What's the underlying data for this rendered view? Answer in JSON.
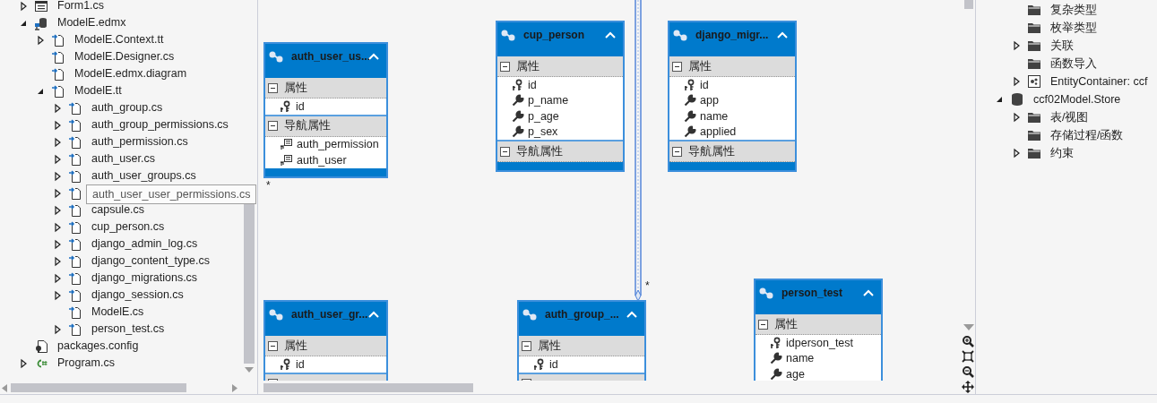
{
  "solution_tree": [
    {
      "label": "Form1.cs",
      "kind": "form",
      "expanded": false
    },
    {
      "label": "ModelE.edmx",
      "kind": "edmx",
      "expanded": true,
      "children": [
        {
          "label": "ModelE.Context.tt",
          "kind": "tt",
          "expanded": false
        },
        {
          "label": "ModelE.Designer.cs",
          "kind": "tt"
        },
        {
          "label": "ModelE.edmx.diagram",
          "kind": "tt"
        },
        {
          "label": "ModelE.tt",
          "kind": "tt",
          "expanded": true,
          "children": [
            {
              "label": "auth_group.cs",
              "kind": "tt",
              "expanded": false
            },
            {
              "label": "auth_group_permissions.cs",
              "kind": "tt",
              "expanded": false
            },
            {
              "label": "auth_permission.cs",
              "kind": "tt",
              "expanded": false
            },
            {
              "label": "auth_user.cs",
              "kind": "tt",
              "expanded": false
            },
            {
              "label": "auth_user_groups.cs",
              "kind": "tt",
              "expanded": false
            },
            {
              "kind": "tt",
              "expanded": false
            },
            {
              "label": "capsule.cs",
              "kind": "tt",
              "expanded": false
            },
            {
              "label": "cup_person.cs",
              "kind": "tt",
              "expanded": false
            },
            {
              "label": "django_admin_log.cs",
              "kind": "tt",
              "expanded": false
            },
            {
              "label": "django_content_type.cs",
              "kind": "tt",
              "expanded": false
            },
            {
              "label": "django_migrations.cs",
              "kind": "tt",
              "expanded": false
            },
            {
              "label": "django_session.cs",
              "kind": "tt",
              "expanded": false
            },
            {
              "label": "ModelE.cs",
              "kind": "tt"
            },
            {
              "label": "person_test.cs",
              "kind": "tt",
              "expanded": false
            }
          ]
        }
      ]
    },
    {
      "label": "packages.config",
      "kind": "config"
    },
    {
      "label": "Program.cs",
      "kind": "csharp",
      "expanded": false
    }
  ],
  "tooltip": {
    "text": "auth_user_user_permissions.cs"
  },
  "entities": [
    {
      "title": "auth_user_us...",
      "expanded": true,
      "sections": [
        {
          "label": "属性",
          "expanded": true,
          "rows": [
            {
              "name": "id",
              "kind": "key"
            }
          ]
        },
        {
          "label": "导航属性",
          "expanded": true,
          "rows": [
            {
              "name": "auth_permission",
              "kind": "navigation"
            },
            {
              "name": "auth_user",
              "kind": "navigation"
            }
          ]
        }
      ]
    },
    {
      "title": "cup_person",
      "expanded": true,
      "sections": [
        {
          "label": "属性",
          "expanded": true,
          "rows": [
            {
              "name": "id",
              "kind": "key"
            },
            {
              "name": "p_name",
              "kind": "property"
            },
            {
              "name": "p_age",
              "kind": "property"
            },
            {
              "name": "p_sex",
              "kind": "property"
            }
          ]
        },
        {
          "label": "导航属性",
          "expanded": true
        }
      ]
    },
    {
      "title": "django_migr...",
      "expanded": true,
      "sections": [
        {
          "label": "属性",
          "expanded": true,
          "rows": [
            {
              "name": "id",
              "kind": "key"
            },
            {
              "name": "app",
              "kind": "property"
            },
            {
              "name": "name",
              "kind": "property"
            },
            {
              "name": "applied",
              "kind": "property"
            }
          ]
        },
        {
          "label": "导航属性",
          "expanded": true
        }
      ]
    },
    {
      "title": "auth_user_gr...",
      "expanded": true,
      "sections": [
        {
          "label": "属性",
          "expanded": true,
          "rows": [
            {
              "name": "id",
              "kind": "key"
            }
          ]
        },
        {
          "expanded": true
        }
      ]
    },
    {
      "title": "auth_group_...",
      "expanded": true,
      "sections": [
        {
          "label": "属性",
          "expanded": true,
          "rows": [
            {
              "name": "id",
              "kind": "key"
            }
          ]
        },
        {
          "expanded": true
        }
      ]
    },
    {
      "title": "person_test",
      "expanded": true,
      "sections": [
        {
          "label": "属性",
          "expanded": true,
          "rows": [
            {
              "name": "idperson_test",
              "kind": "key"
            },
            {
              "name": "name",
              "kind": "property"
            },
            {
              "name": "age",
              "kind": "property"
            }
          ]
        }
      ]
    }
  ],
  "multiplicity_labels": [
    "*",
    "*"
  ],
  "model_browser": {
    "continued_items": [
      {
        "label": "复杂类型",
        "kind": "folder"
      },
      {
        "label": "枚举类型",
        "kind": "folder"
      },
      {
        "label": "关联",
        "kind": "folder",
        "expanded": false
      },
      {
        "label": "函数导入",
        "kind": "folder"
      },
      {
        "label": "EntityContainer: ccf",
        "kind": "container",
        "expanded": false
      }
    ],
    "items": [
      {
        "label": "ccf02Model.Store",
        "kind": "database",
        "expanded": true,
        "children": [
          {
            "label": "表/视图",
            "kind": "folder",
            "expanded": false
          },
          {
            "label": "存储过程/函数",
            "kind": "folder"
          },
          {
            "label": "约束",
            "kind": "folder",
            "expanded": false
          }
        ]
      }
    ]
  }
}
